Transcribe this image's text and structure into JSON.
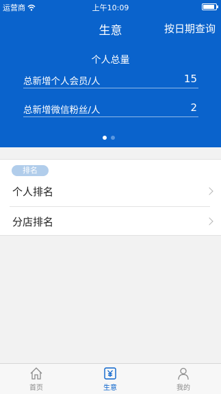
{
  "status_bar": {
    "carrier": "运营商",
    "time": "上午10:09"
  },
  "nav": {
    "title": "生意",
    "right_action": "按日期查询"
  },
  "summary": {
    "title": "个人总量",
    "rows": [
      {
        "label": "总新增个人会员/人",
        "value": "15"
      },
      {
        "label": "总新增微信粉丝/人",
        "value": "2"
      }
    ],
    "page_indicator": {
      "pages": 2,
      "active": 1
    }
  },
  "ranking": {
    "tag": "排名",
    "items": [
      {
        "label": "个人排名"
      },
      {
        "label": "分店排名"
      }
    ]
  },
  "tabbar": {
    "tabs": [
      {
        "label": "首页",
        "icon": "home-icon"
      },
      {
        "label": "生意",
        "icon": "yen-icon",
        "active": true
      },
      {
        "label": "我的",
        "icon": "person-icon"
      }
    ]
  },
  "colors": {
    "primary": "#0a63cc",
    "tag_bg": "#b1cdeb",
    "background": "#f2f2f2"
  }
}
